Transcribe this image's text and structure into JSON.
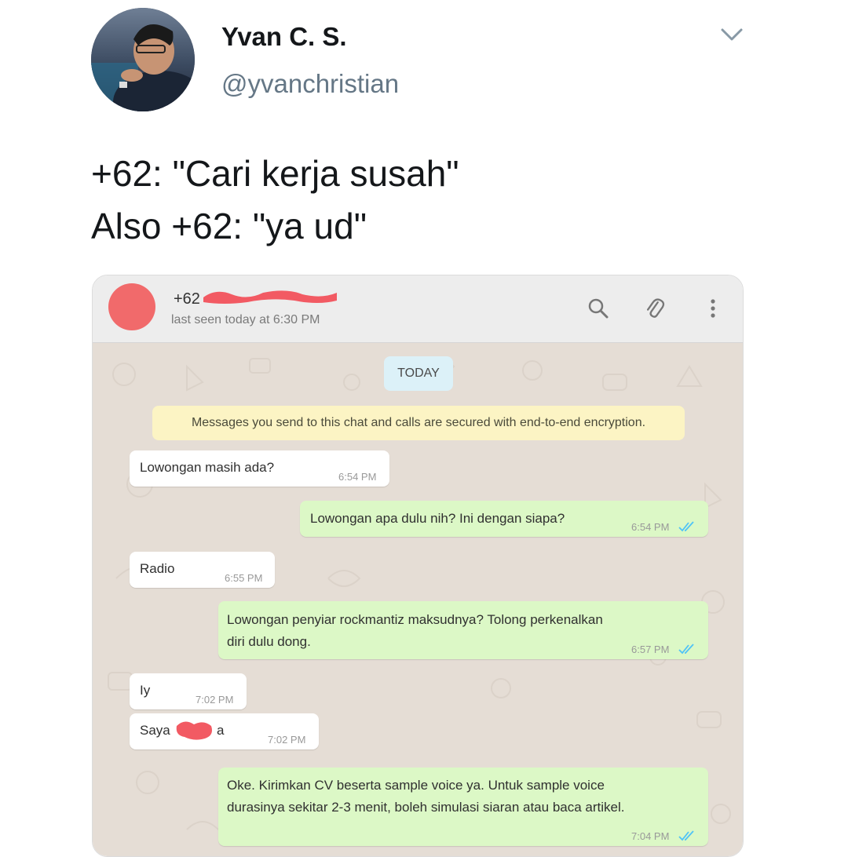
{
  "tweet": {
    "author_name": "Yvan C. S.",
    "author_handle": "@yvanchristian",
    "lines": [
      "+62: \"Cari kerja susah\"",
      "Also +62: \"ya ud\""
    ]
  },
  "chat": {
    "contact_name_prefix": "+62",
    "last_seen": "last seen today at 6:30 PM",
    "day_label": "TODAY",
    "encryption_notice": "Messages you send to this chat and calls are secured with end-to-end encryption.",
    "messages": [
      {
        "direction": "in",
        "lines": [
          "Lowongan masih ada?"
        ],
        "time": "6:54 PM"
      },
      {
        "direction": "out",
        "lines": [
          "Lowongan apa dulu nih? Ini dengan siapa?"
        ],
        "time": "6:54 PM",
        "status": "read"
      },
      {
        "direction": "in",
        "lines": [
          "Radio"
        ],
        "time": "6:55 PM"
      },
      {
        "direction": "out",
        "lines": [
          "Lowongan penyiar rockmantiz maksudnya? Tolong perkenalkan",
          "diri dulu dong."
        ],
        "time": "6:57 PM",
        "status": "read"
      },
      {
        "direction": "in",
        "lines": [
          "Iy"
        ],
        "time": "7:02 PM"
      },
      {
        "direction": "in",
        "lines": [
          "Saya",
          "a"
        ],
        "time": "7:02 PM"
      },
      {
        "direction": "out",
        "lines": [
          "Oke. Kirimkan CV beserta sample voice ya. Untuk sample voice",
          "durasinya sekitar 2-3 menit, boleh simulasi siaran atau baca artikel."
        ],
        "time": "7:04 PM",
        "status": "read"
      }
    ]
  },
  "colors": {
    "wallpaper": "#e5ddd5",
    "incoming_bubble": "#ffffff",
    "outgoing_bubble": "#dcf8c6",
    "read_ticks": "#4fc3f7",
    "redaction": "#f25a63",
    "contact_avatar": "#f16a6b"
  },
  "icons": [
    "chevron-down-icon",
    "search-icon",
    "paperclip-icon",
    "more-vertical-icon",
    "double-check-icon"
  ]
}
